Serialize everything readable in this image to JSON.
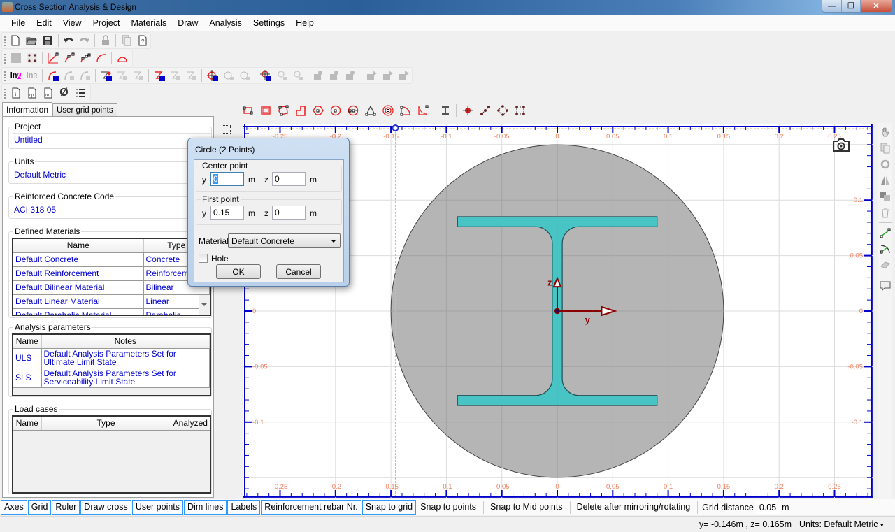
{
  "window": {
    "title": "Cross Section Analysis & Design",
    "minimize": "—",
    "restore": "❐",
    "close": "✕"
  },
  "menu": [
    "File",
    "Edit",
    "View",
    "Project",
    "Materials",
    "Draw",
    "Analysis",
    "Settings",
    "Help"
  ],
  "toolbars": {
    "row1": [
      "new-file",
      "open-folder",
      "save",
      "undo",
      "redo",
      "lock",
      "copy-pages",
      "help-document"
    ],
    "row2": [
      "grid-points-disabled",
      "grid-points",
      "line-2-points",
      "polyline-2",
      "polyline-3",
      "arc",
      "half-circle"
    ],
    "row3": [
      "info-A",
      "info-R",
      "arc-L",
      "arc-A",
      "arc-R",
      "rebar-add-L",
      "rebar-add-A",
      "rebar-add-R",
      "line-L",
      "line-A",
      "line-R",
      "circle-L",
      "circle-A",
      "circle-R",
      "point-L",
      "point-A",
      "point-R",
      "building-L",
      "building-A",
      "building-R",
      "building-flag-L",
      "building-flag-A",
      "building-flag-R"
    ],
    "row4": [
      "info-doc",
      "cp-doc",
      "re-doc",
      "diameter",
      "numbered-list"
    ]
  },
  "left_panel": {
    "tabs": [
      {
        "label": "Information",
        "active": true
      },
      {
        "label": "User grid points",
        "active": false
      }
    ],
    "project": {
      "legend": "Project",
      "value": "Untitled"
    },
    "units": {
      "legend": "Units",
      "value": "Default Metric"
    },
    "code": {
      "legend": "Reinforced Concrete Code",
      "value": "ACI 318 05"
    },
    "materials": {
      "legend": "Defined Materials",
      "columns": [
        "Name",
        "Type"
      ],
      "rows": [
        [
          "Default Concrete",
          "Concrete"
        ],
        [
          "Default Reinforcement",
          "Reinforcement"
        ],
        [
          "Default Bilinear Material",
          "Bilinear"
        ],
        [
          "Default Linear Material",
          "Linear"
        ],
        [
          "Default Parabolic Material",
          "Parabolic"
        ]
      ]
    },
    "analysis": {
      "legend": "Analysis parameters",
      "columns": [
        "Name",
        "Notes"
      ],
      "rows": [
        [
          "ULS",
          "Default Analysis Parameters Set for Ultimate Limit State"
        ],
        [
          "SLS",
          "Default Analysis Parameters Set for Serviceability Limit State"
        ]
      ]
    },
    "load_cases": {
      "legend": "Load cases",
      "columns": [
        "Name",
        "Type",
        "Analyzed"
      ],
      "rows": []
    }
  },
  "draw_tools": [
    "rectangle",
    "rectangle-filled",
    "polygon",
    "l-shape",
    "hexagon",
    "circle-center",
    "circle-2-points",
    "triangle",
    "concentric-circles",
    "circular-sector",
    "parabolic-corner",
    "i-section",
    "point",
    "line-points",
    "diamond-points",
    "square-points"
  ],
  "right_tools": [
    "pan-hand",
    "copy",
    "rotate",
    "mirror",
    "move",
    "delete",
    "line-tool",
    "arc-tool",
    "erase",
    "comment"
  ],
  "canvas": {
    "x_ticks": [
      "-0.25",
      "-0.2",
      "-0.15",
      "-0.1",
      "-0.05",
      "0",
      "0.05",
      "0.1",
      "0.15",
      "0.2",
      "0.25"
    ],
    "y_ticks": [
      "0.1",
      "0.05",
      "0",
      "-0.05",
      "-0.1"
    ],
    "x_tick_values": [
      -0.25,
      -0.2,
      -0.15,
      -0.1,
      -0.05,
      0,
      0.05,
      0.1,
      0.15,
      0.2,
      0.25
    ],
    "y_tick_values": [
      0.1,
      0.05,
      0,
      -0.05,
      -0.1
    ],
    "axis_y_label": "y",
    "axis_z_label": "z",
    "circle_radius_m": 0.15,
    "circle_color": "#b4b4b4",
    "steel_color": "#48c4c4",
    "axis_color": "#8b0000",
    "ruler_color": "#0000cc",
    "tick_label_color": "#f08060",
    "cursor_y": -0.146,
    "i_section": {
      "flange_half_width": 0.09,
      "flange_outer_z": 0.085,
      "flange_inner_z": 0.076,
      "web_half_thickness": 0.0045,
      "fillet_radius": 0.015
    }
  },
  "dialog": {
    "title": "Circle (2 Points)",
    "center_legend": "Center point",
    "first_legend": "First point",
    "y_label": "y",
    "z_label": "z",
    "unit": "m",
    "center_y": "0",
    "center_z": "0",
    "first_y": "0.15",
    "first_z": "0",
    "material_label": "Material",
    "material_value": "Default Concrete",
    "hole_label": "Hole",
    "hole_checked": false,
    "ok": "OK",
    "cancel": "Cancel"
  },
  "bottom_toggles": [
    {
      "label": "Axes",
      "on": true
    },
    {
      "label": "Grid",
      "on": true
    },
    {
      "label": "Ruler",
      "on": true
    },
    {
      "label": "Draw cross",
      "on": true
    },
    {
      "label": "User points",
      "on": true
    },
    {
      "label": "Dim lines",
      "on": true
    },
    {
      "label": "Labels",
      "on": true
    },
    {
      "label": "Reinforcement rebar Nr.",
      "on": true
    },
    {
      "label": "Snap to grid",
      "on": true
    },
    {
      "label": "Snap to points",
      "on": false
    },
    {
      "label": "Snap to Mid points",
      "on": false
    },
    {
      "label": "Delete after mirroring/rotating",
      "on": false
    }
  ],
  "grid_distance": {
    "label": "Grid distance",
    "value": "0.05",
    "unit": "m"
  },
  "status": {
    "coords": "y= -0.146m , z= 0.165m",
    "units": "Units: Default Metric"
  }
}
